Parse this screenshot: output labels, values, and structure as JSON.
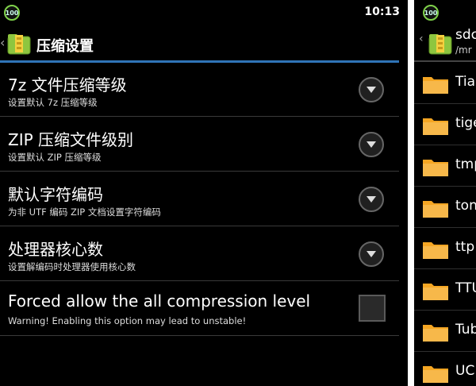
{
  "status": {
    "badge": "100",
    "time": "10:13"
  },
  "header": {
    "title": "压缩设置"
  },
  "settings": [
    {
      "title": "7z 文件压缩等级",
      "subtitle": "设置默认 7z 压缩等级",
      "control": "dropdown"
    },
    {
      "title": "ZIP 压缩文件级别",
      "subtitle": "设置默认 ZIP 压缩等级",
      "control": "dropdown"
    },
    {
      "title": "默认字符编码",
      "subtitle": "为非 UTF 编码 ZIP 文档设置字符编码",
      "control": "dropdown"
    },
    {
      "title": "处理器核心数",
      "subtitle": "设置解编码时处理器使用核心数",
      "control": "dropdown"
    },
    {
      "title": "Forced allow the all compression level",
      "subtitle": "Warning! Enabling this option may lead to unstable!",
      "control": "checkbox",
      "checked": false
    }
  ],
  "right_panel": {
    "badge": "100",
    "title": "sdc",
    "path": "/mr",
    "folders": [
      "Tia",
      "tige",
      "tmp",
      "ton",
      "ttp",
      "TTU",
      "Tub",
      "UC"
    ]
  },
  "colors": {
    "accent": "#2f74b7",
    "folder": "#f5a623",
    "badge_ring": "#7fd14a"
  }
}
